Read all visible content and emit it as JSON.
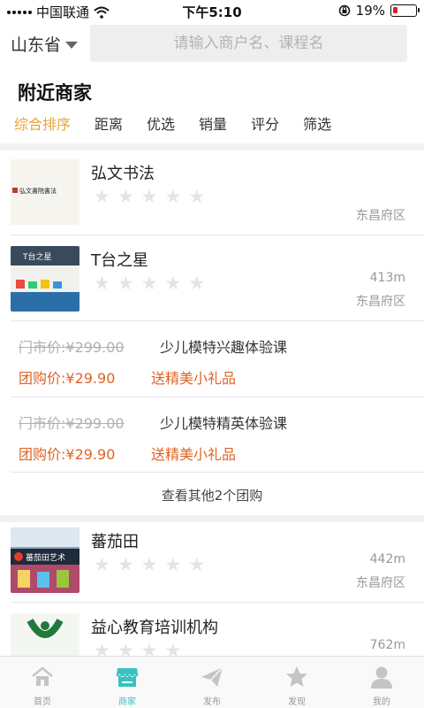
{
  "status_bar": {
    "carrier": "中国联通",
    "time": "下午5:10",
    "battery_text": "19%",
    "battery_level": 0.19
  },
  "header": {
    "province": "山东省",
    "search_placeholder": "请输入商户名、课程名"
  },
  "section_title": "附近商家",
  "sort_tabs": [
    "综合排序",
    "距离",
    "优选",
    "销量",
    "评分",
    "筛选"
  ],
  "merchants": [
    {
      "name": "弘文书法",
      "rating": 0,
      "distance": "",
      "area": "东昌府区",
      "thumb_text": "弘文書院書法"
    },
    {
      "name": "T台之星",
      "rating": 0,
      "distance": "413m",
      "area": "东昌府区",
      "thumb_text": "T台之星",
      "deals": [
        {
          "original_price": "门市价:¥299.00",
          "title": "少儿模特兴趣体验课",
          "group_price": "团购价:¥29.90",
          "gift": "送精美小礼品"
        },
        {
          "original_price": "门市价:¥299.00",
          "title": "少儿模特精英体验课",
          "group_price": "团购价:¥29.90",
          "gift": "送精美小礼品"
        }
      ],
      "more_deals": "查看其他2个团购"
    },
    {
      "name": "蕃茄田",
      "rating": 0,
      "distance": "442m",
      "area": "东昌府区",
      "thumb_text": "蕃茄田艺术"
    },
    {
      "name": "益心教育培训机构",
      "rating": 0,
      "distance": "762m",
      "area": ""
    }
  ],
  "tab_bar": {
    "active": "商家",
    "tabs": [
      {
        "label": "首页",
        "icon": "home-icon"
      },
      {
        "label": "商家",
        "icon": "store-icon"
      },
      {
        "label": "发布",
        "icon": "paper-plane-icon"
      },
      {
        "label": "发现",
        "icon": "star-icon"
      },
      {
        "label": "我的",
        "icon": "user-icon"
      }
    ]
  },
  "colors": {
    "accent_orange": "#e8a33a",
    "price_orange": "#e06326",
    "tab_active": "#36c3c2",
    "star_empty": "#e4e4e4"
  }
}
